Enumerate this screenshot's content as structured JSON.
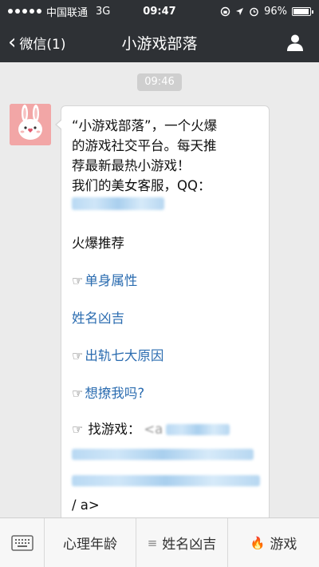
{
  "status_bar": {
    "carrier": "中国联通",
    "network": "3G",
    "time": "09:47",
    "battery": "96%",
    "battery_level": 0.96
  },
  "nav": {
    "back_label": "微信(1)",
    "title": "小游戏部落"
  },
  "chat": {
    "timestamp": "09:46",
    "message": {
      "intro": "“小游戏部落”，一个火爆\n的游戏社交平台。每天推\n荐最新最热小游戏！\n  我们的美女客服，QQ：",
      "section_title": "火爆推荐",
      "links": [
        {
          "hand": "☞",
          "label": "单身属性"
        },
        {
          "hand": "",
          "label": "姓名凶吉"
        },
        {
          "hand": "☞",
          "label": "出轨七大原因"
        },
        {
          "hand": "☞",
          "label": "想撩我吗?"
        }
      ],
      "find_hand": "☞",
      "find_label": "找游戏：",
      "find_prefix": "<a",
      "closing": "/ a>"
    }
  },
  "bottom_menu": {
    "items": [
      {
        "label": "心理年龄",
        "glyph": ""
      },
      {
        "label": "姓名凶吉",
        "glyph": "≡"
      },
      {
        "label": "游戏",
        "glyph": "🔥"
      }
    ]
  },
  "colors": {
    "header_bg": "#2e3135",
    "chat_bg": "#ebebeb",
    "link": "#2b6cb0"
  }
}
